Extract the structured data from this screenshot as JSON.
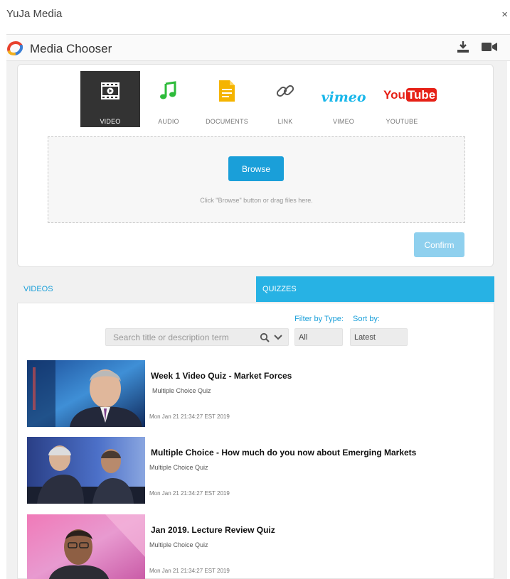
{
  "window": {
    "title": "YuJa Media",
    "close": "×"
  },
  "header": {
    "title": "Media Chooser",
    "icons": [
      "yuja-logo-icon",
      "download-icon",
      "video-camera-icon"
    ]
  },
  "media_types": [
    {
      "label": "VIDEO",
      "icon": "video-film-icon",
      "active": true
    },
    {
      "label": "AUDIO",
      "icon": "music-note-icon",
      "active": false
    },
    {
      "label": "DOCUMENTS",
      "icon": "document-icon",
      "active": false
    },
    {
      "label": "LINK",
      "icon": "link-chain-icon",
      "active": false
    },
    {
      "label": "VIMEO",
      "icon": "vimeo-logo",
      "logo_text": "vimeo",
      "active": false
    },
    {
      "label": "YOUTUBE",
      "icon": "youtube-logo",
      "logo_text_a": "You",
      "logo_text_b": "Tube",
      "active": false
    }
  ],
  "upload": {
    "browse_label": "Browse",
    "hint": "Click \"Browse\" button or drag files here.",
    "confirm_label": "Confirm"
  },
  "tabs": [
    {
      "label": "VIDEOS",
      "active": false
    },
    {
      "label": "QUIZZES",
      "active": true
    }
  ],
  "filters": {
    "search_placeholder": "Search title or description term",
    "filter_by_type_label": "Filter by Type:",
    "filter_by_type_value": "All",
    "sort_by_label": "Sort by:",
    "sort_by_value": "Latest"
  },
  "quizzes": [
    {
      "title": "Week 1 Video Quiz - Market Forces",
      "type": "Multiple Choice Quiz",
      "date": "Mon Jan 21 21:34:27 EST 2019"
    },
    {
      "title": "Multiple Choice - How much do you now about Emerging Markets",
      "type": "Multiple Choice Quiz",
      "date": "Mon Jan 21 21:34:27 EST 2019"
    },
    {
      "title": "Jan 2019. Lecture Review Quiz",
      "type": "Multiple Choice Quiz",
      "date": "Mon Jan 21 21:34:27 EST 2019"
    }
  ],
  "colors": {
    "accent": "#1a9fd9",
    "tab_active": "#27b2e4",
    "confirm_disabled": "#8fd0ee",
    "audio_green": "#2dbb3a",
    "documents_yellow": "#f5b400",
    "vimeo_blue": "#1ab7ea",
    "youtube_red": "#e62117"
  }
}
